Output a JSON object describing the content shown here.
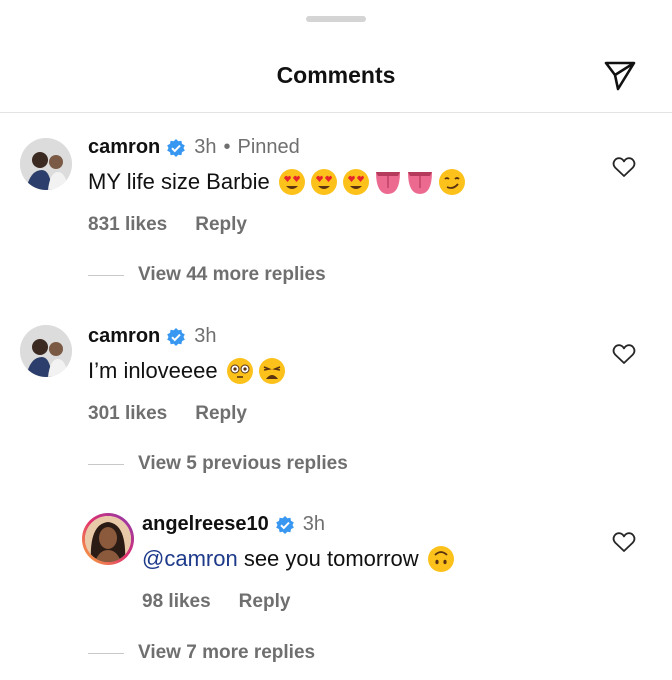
{
  "header": {
    "title": "Comments",
    "share_icon": "send-icon"
  },
  "comments": [
    {
      "username": "camron",
      "verified": true,
      "time": "3h",
      "separator": "•",
      "pinned_label": "Pinned",
      "text": "MY life size Barbie",
      "emojis": [
        "heart-eyes",
        "heart-eyes",
        "heart-eyes",
        "tongue",
        "tongue",
        "smirk"
      ],
      "likes": "831 likes",
      "reply_label": "Reply",
      "view_replies": "View 44 more replies"
    },
    {
      "username": "camron",
      "verified": true,
      "time": "3h",
      "text": "I’m inloveeee",
      "emojis": [
        "flushed",
        "weary"
      ],
      "likes": "301 likes",
      "reply_label": "Reply",
      "view_previous": "View 5 previous replies"
    }
  ],
  "reply": {
    "username": "angelreese10",
    "verified": true,
    "time": "3h",
    "mention": "@camron",
    "text": " see you tomorrow",
    "emojis": [
      "upside-down"
    ],
    "likes": "98 likes",
    "reply_label": "Reply",
    "view_more": "View 7 more replies"
  },
  "colors": {
    "verified": "#3897f0",
    "muted": "#6f6f6f",
    "mention": "#1e3a8a"
  }
}
